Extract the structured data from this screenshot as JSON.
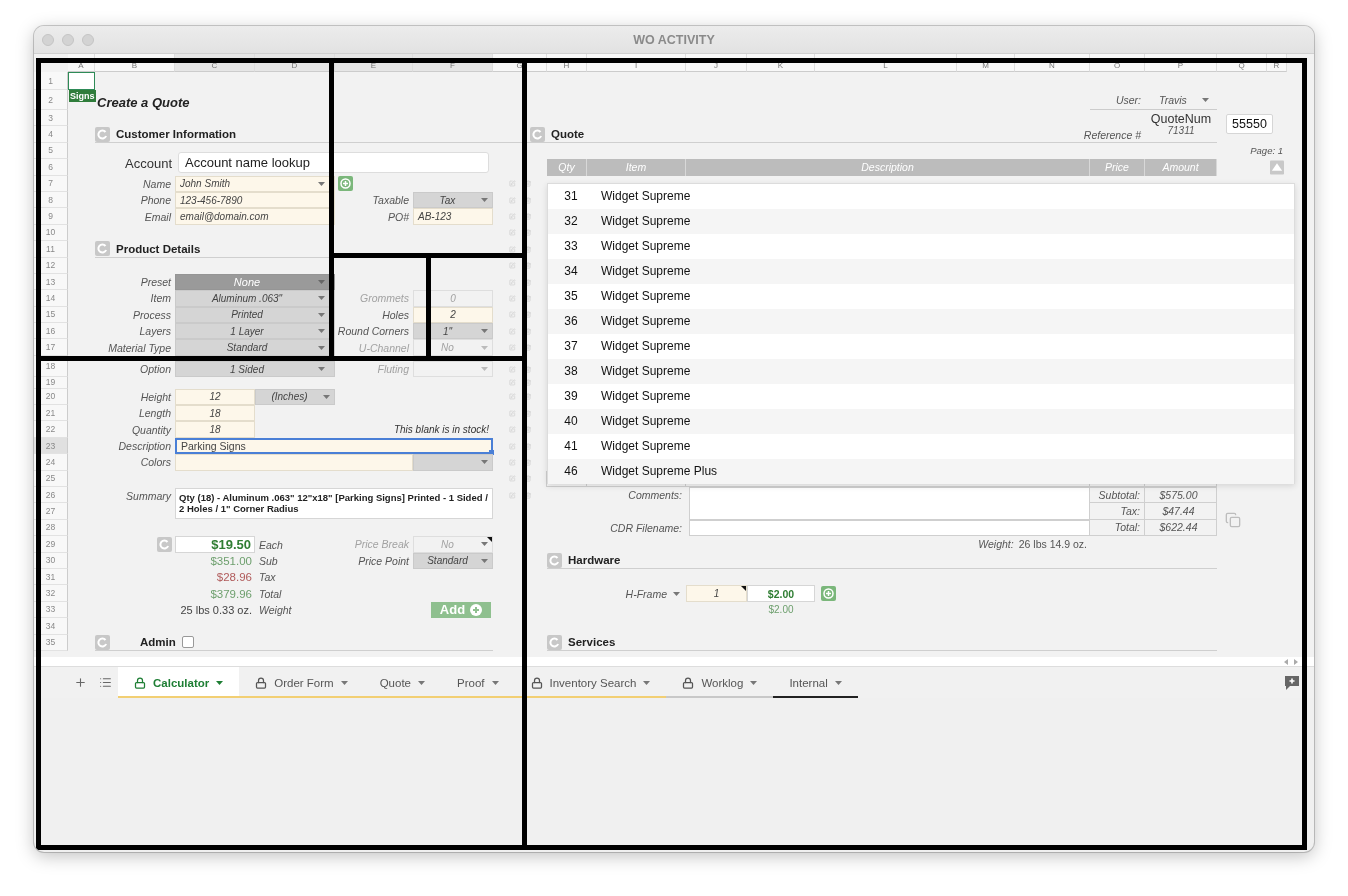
{
  "window": {
    "title": "WO ACTIVITY"
  },
  "sheet": {
    "columns": [
      "A",
      "B",
      "C",
      "D",
      "E",
      "F",
      "G",
      "H",
      "I",
      "J",
      "K",
      "L",
      "M",
      "N",
      "O",
      "P",
      "Q",
      "R"
    ],
    "rows": [
      "1",
      "2",
      "3",
      "4",
      "5",
      "6",
      "7",
      "8",
      "9",
      "10",
      "11",
      "12",
      "13",
      "14",
      "15",
      "16",
      "17",
      "18",
      "19",
      "20",
      "21",
      "22",
      "23",
      "24",
      "25",
      "26",
      "27",
      "28",
      "29",
      "30",
      "31",
      "32",
      "33",
      "34",
      "35"
    ]
  },
  "logo": "Signs",
  "page_title": "Create a Quote",
  "customer": {
    "title": "Customer Information",
    "account": {
      "label": "Account",
      "placeholder": "Account name lookup"
    },
    "fields": [
      {
        "label": "Name",
        "value": "John Smith",
        "kind": "dropdown"
      },
      {
        "label": "Phone",
        "value": "123-456-7890",
        "kind": "text"
      },
      {
        "label": "Email",
        "value": "email@domain.com",
        "kind": "text"
      }
    ],
    "taxable": {
      "label": "Taxable",
      "value": "Tax"
    },
    "po": {
      "label": "PO#",
      "value": "AB-123"
    }
  },
  "product": {
    "title": "Product Details",
    "options": [
      {
        "label": "Preset",
        "value": "None",
        "kind": "preset"
      },
      {
        "label": "Item",
        "value": "Aluminum .063\"",
        "kind": "dropdown"
      },
      {
        "label": "Process",
        "value": "Printed",
        "kind": "dropdown"
      },
      {
        "label": "Layers",
        "value": "1 Layer",
        "kind": "dropdown"
      },
      {
        "label": "Material Type",
        "value": "Standard",
        "kind": "dropdown"
      },
      {
        "label": "Option",
        "value": "1 Sided",
        "kind": "dropdown"
      }
    ],
    "extras": [
      {
        "label": "Grommets",
        "value": "0",
        "kind": "number",
        "disabled": true
      },
      {
        "label": "Holes",
        "value": "2",
        "kind": "number",
        "disabled": false
      },
      {
        "label": "Round Corners",
        "value": "1\"",
        "kind": "dropdown",
        "disabled": false
      },
      {
        "label": "U-Channel",
        "value": "No",
        "kind": "dropdown",
        "disabled": true
      },
      {
        "label": "Fluting",
        "kind": "dropdown",
        "disabled": true
      }
    ]
  },
  "size": {
    "height": {
      "label": "Height",
      "value": "12",
      "unit": "(Inches)"
    },
    "length": {
      "label": "Length",
      "value": "18"
    },
    "quantity": {
      "label": "Quantity",
      "value": "18"
    },
    "stock_note": "This blank is in stock!",
    "description": {
      "label": "Description",
      "value": "Parking Signs",
      "focused": true
    },
    "colors": {
      "label": "Colors"
    },
    "summary": {
      "label": "Summary",
      "value": "Qty (18) - Aluminum .063\" 12\"x18\" [Parking Signs] Printed - 1 Sided / 2 Holes / 1\" Corner Radius"
    }
  },
  "pricing": {
    "lines": [
      {
        "value": "$19.50",
        "suffix": "Each",
        "kind": "each"
      },
      {
        "value": "$351.00",
        "suffix": "Sub",
        "kind": "sub"
      },
      {
        "value": "$28.96",
        "suffix": "Tax",
        "kind": "tax"
      },
      {
        "value": "$379.96",
        "suffix": "Total",
        "kind": "total"
      },
      {
        "value": "25 lbs 0.33 oz.",
        "suffix": "Weight",
        "kind": "weight"
      }
    ],
    "price_break": {
      "label": "Price Break",
      "value": "No",
      "disabled": true
    },
    "price_point": {
      "label": "Price Point",
      "value": "Standard",
      "disabled": false
    },
    "add_button": "Add"
  },
  "admin": {
    "label": "Admin",
    "checked": false
  },
  "quote": {
    "title": "Quote",
    "user": {
      "label": "User:",
      "value": "Travis"
    },
    "quote_num": {
      "label": "QuoteNum",
      "value": "55550"
    },
    "reference": {
      "label": "Reference #",
      "value": "71311"
    },
    "page": {
      "label": "Page:",
      "value": "1"
    },
    "columns": [
      "Qty",
      "Item",
      "Description",
      "Price",
      "Amount"
    ],
    "suggestions": [
      {
        "number": "31",
        "name": "Widget Supreme"
      },
      {
        "number": "32",
        "name": "Widget Supreme"
      },
      {
        "number": "33",
        "name": "Widget Supreme"
      },
      {
        "number": "34",
        "name": "Widget Supreme"
      },
      {
        "number": "35",
        "name": "Widget Supreme"
      },
      {
        "number": "36",
        "name": "Widget Supreme"
      },
      {
        "number": "37",
        "name": "Widget Supreme"
      },
      {
        "number": "38",
        "name": "Widget Supreme"
      },
      {
        "number": "39",
        "name": "Widget Supreme"
      },
      {
        "number": "40",
        "name": "Widget Supreme"
      },
      {
        "number": "41",
        "name": "Widget Supreme"
      },
      {
        "number": "46",
        "name": "Widget Supreme Plus"
      }
    ],
    "comments_label": "Comments:",
    "cdr_label": "CDR Filename:",
    "totals": [
      {
        "label": "Subtotal:",
        "value": "$575.00"
      },
      {
        "label": "Tax:",
        "value": "$47.44"
      },
      {
        "label": "Total:",
        "value": "$622.44"
      }
    ],
    "weight": {
      "label": "Weight:",
      "value": "26 lbs 14.9 oz."
    }
  },
  "hardware": {
    "title": "Hardware",
    "item": {
      "label": "H-Frame",
      "quantity": "1",
      "price": "$2.00",
      "total": "$2.00"
    }
  },
  "services": {
    "title": "Services"
  },
  "tabs": [
    {
      "label": "Calculator",
      "locked": true,
      "selected": true,
      "color": "#f2cf73"
    },
    {
      "label": "Order Form",
      "locked": true,
      "selected": false,
      "color": "#f2cf73"
    },
    {
      "label": "Quote",
      "locked": false,
      "selected": false,
      "color": "#f2cf73"
    },
    {
      "label": "Proof",
      "locked": false,
      "selected": false,
      "color": "#f2cf73"
    },
    {
      "label": "Inventory Search",
      "locked": true,
      "selected": false,
      "color": "#f2cf73"
    },
    {
      "label": "Worklog",
      "locked": true,
      "selected": false,
      "color": "#c8c8c8"
    },
    {
      "label": "Internal",
      "locked": false,
      "selected": false,
      "color": "#222222"
    }
  ]
}
